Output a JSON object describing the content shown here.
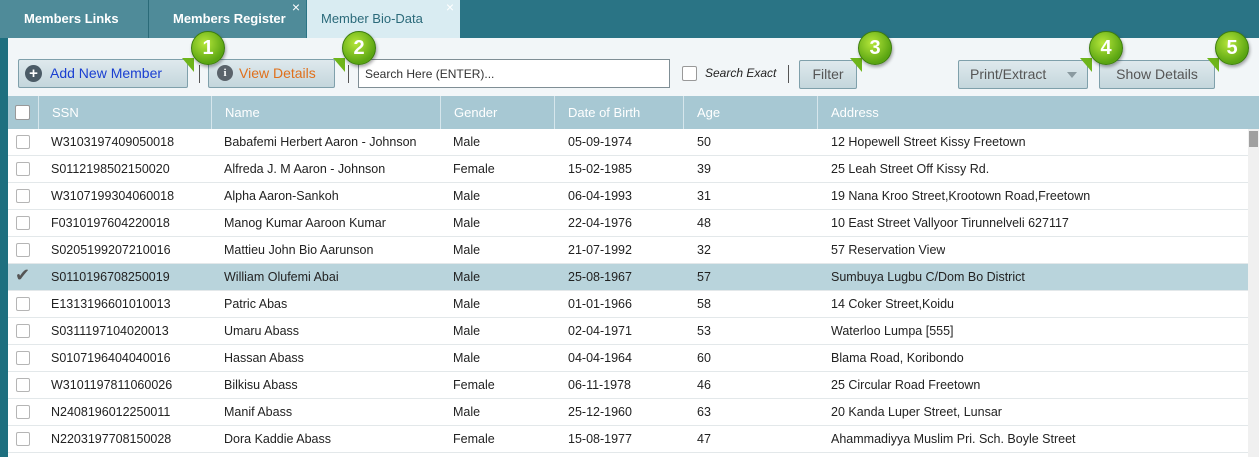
{
  "tabs": [
    {
      "label": "Members Links"
    },
    {
      "label": "Members Register",
      "close": "×"
    },
    {
      "label": "Member Bio-Data",
      "close": "×"
    }
  ],
  "toolbar": {
    "add_label": "Add New Member",
    "view_label": "View Details",
    "search_placeholder": "Search Here (ENTER)...",
    "search_exact_label": "Search Exact",
    "filter_label": "Filter",
    "print_label": "Print/Extract",
    "show_label": "Show Details"
  },
  "markers": [
    "1",
    "2",
    "3",
    "4",
    "5"
  ],
  "colors": {
    "marker": "#6eb51a",
    "header": "#a7c8d3",
    "selected_row": "#b9d4dc",
    "tab_bar": "#2a7485"
  },
  "table": {
    "columns": [
      "SSN",
      "Name",
      "Gender",
      "Date of Birth",
      "Age",
      "Address"
    ],
    "rows": [
      {
        "ssn": "W3103197409050018",
        "name": "Babafemi Herbert Aaron - Johnson",
        "gender": "Male",
        "dob": "05-09-1974",
        "age": "50",
        "address": "12 Hopewell Street Kissy Freetown"
      },
      {
        "ssn": "S0112198502150020",
        "name": "Alfreda J. M Aaron - Johnson",
        "gender": "Female",
        "dob": "15-02-1985",
        "age": "39",
        "address": "25 Leah Street Off Kissy Rd."
      },
      {
        "ssn": "W3107199304060018",
        "name": "Alpha Aaron-Sankoh",
        "gender": "Male",
        "dob": "06-04-1993",
        "age": "31",
        "address": "19 Nana Kroo Street,Krootown Road,Freetown"
      },
      {
        "ssn": "F0310197604220018",
        "name": "Manog Kumar Aaroon Kumar",
        "gender": "Male",
        "dob": "22-04-1976",
        "age": "48",
        "address": "10 East Street Vallyoor Tirunnelveli 627117"
      },
      {
        "ssn": "S0205199207210016",
        "name": "Mattieu John Bio Aarunson",
        "gender": "Male",
        "dob": "21-07-1992",
        "age": "32",
        "address": "57 Reservation View"
      },
      {
        "ssn": "S0110196708250019",
        "name": "William Olufemi Abai",
        "gender": "Male",
        "dob": "25-08-1967",
        "age": "57",
        "address": "Sumbuya Lugbu C/Dom Bo District",
        "selected": true
      },
      {
        "ssn": "E1313196601010013",
        "name": "Patric Abas",
        "gender": "Male",
        "dob": "01-01-1966",
        "age": "58",
        "address": "14 Coker Street,Koidu"
      },
      {
        "ssn": "S0311197104020013",
        "name": "Umaru Abass",
        "gender": "Male",
        "dob": "02-04-1971",
        "age": "53",
        "address": "Waterloo Lumpa [555]"
      },
      {
        "ssn": "S0107196404040016",
        "name": "Hassan Abass",
        "gender": "Male",
        "dob": "04-04-1964",
        "age": "60",
        "address": "Blama Road, Koribondo"
      },
      {
        "ssn": "W3101197811060026",
        "name": "Bilkisu Abass",
        "gender": "Female",
        "dob": "06-11-1978",
        "age": "46",
        "address": "25 Circular Road Freetown"
      },
      {
        "ssn": "N2408196012250011",
        "name": "Manif Abass",
        "gender": "Male",
        "dob": "25-12-1960",
        "age": "63",
        "address": "20 Kanda Luper Street, Lunsar"
      },
      {
        "ssn": "N2203197708150028",
        "name": "Dora Kaddie Abass",
        "gender": "Female",
        "dob": "15-08-1977",
        "age": "47",
        "address": "Ahammadiyya Muslim Pri. Sch. Boyle Street"
      }
    ]
  }
}
